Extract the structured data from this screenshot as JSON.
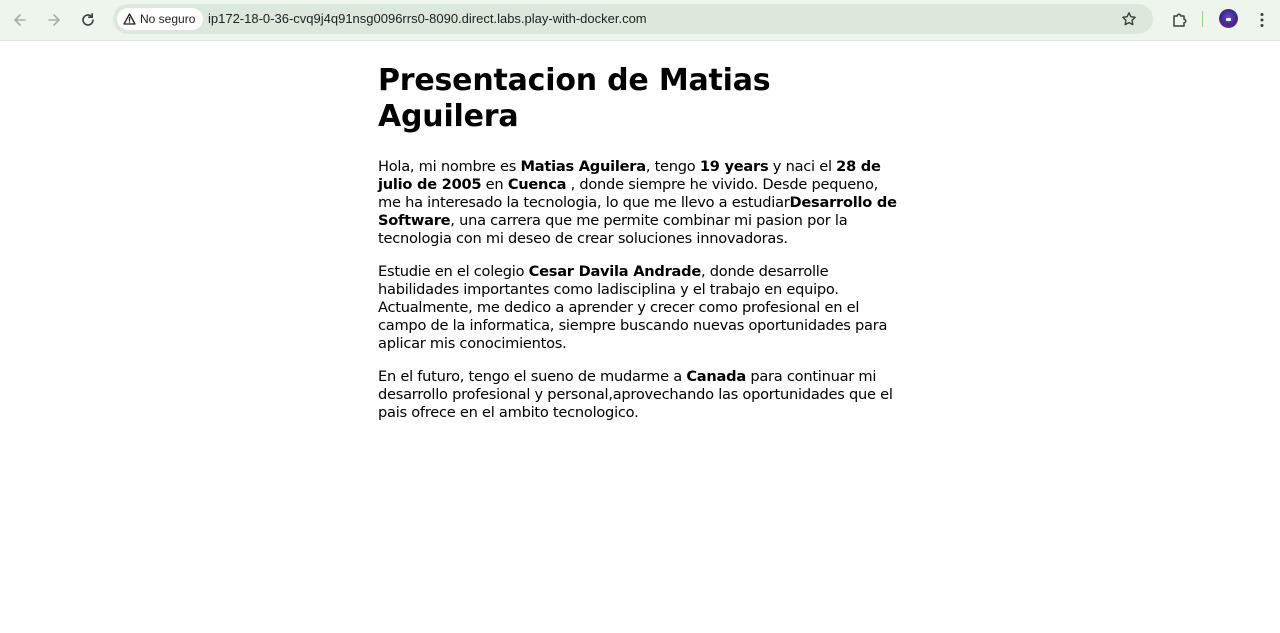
{
  "browser": {
    "security_label": "No seguro",
    "url": "ip172-18-0-36-cvq9j4q91nsg0096rrs0-8090.direct.labs.play-with-docker.com",
    "icons": {
      "back": "arrow-left-icon",
      "forward": "arrow-right-icon",
      "reload": "reload-icon",
      "warning": "warning-triangle-icon",
      "bookmark": "star-icon",
      "extensions": "puzzle-icon",
      "profile": "avatar",
      "menu": "kebab-menu-icon"
    }
  },
  "page": {
    "title": "Presentacion de Matias Aguilera",
    "p1": {
      "t1": "Hola, mi nombre es ",
      "b1": "Matias Aguilera",
      "t2": ", tengo ",
      "b2": "19 years",
      "t3": " y naci el ",
      "b3": "28 de julio de 2005",
      "t4": " en ",
      "b4": "Cuenca",
      "t5": " , donde siempre he vivido. Desde pequeno, me ha interesado la tecnologia, lo que me llevo a estudiar",
      "b5": "Desarrollo de Software",
      "t6": ", una carrera que me permite combinar mi pasion por la tecnologia con mi deseo de crear soluciones innovadoras."
    },
    "p2": {
      "t1": "Estudie en el colegio ",
      "b1": "Cesar Davila Andrade",
      "t2": ", donde desarrolle habilidades importantes como ladisciplina y el trabajo en equipo. Actualmente, me dedico a aprender y crecer como profesional en el campo de la informatica, siempre buscando nuevas oportunidades para aplicar mis conocimientos."
    },
    "p3": {
      "t1": "En el futuro, tengo el sueno de mudarme a ",
      "b1": "Canada",
      "t2": " para continuar mi desarrollo profesional y personal,aprovechando las oportunidades que el pais ofrece en el ambito tecnologico."
    }
  }
}
